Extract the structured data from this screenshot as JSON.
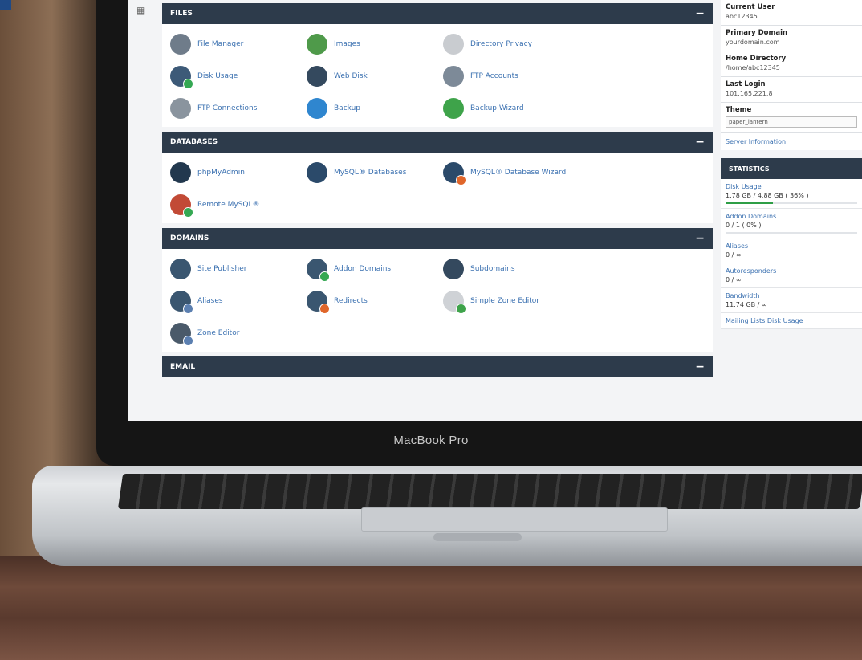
{
  "device": {
    "brand": "MacBook Pro"
  },
  "sections": [
    {
      "title": "FILES",
      "items": [
        {
          "label": "File Manager",
          "color": "#6f7c8a",
          "badge": ""
        },
        {
          "label": "Images",
          "color": "#4f9a4a",
          "badge": ""
        },
        {
          "label": "Directory Privacy",
          "color": "#c9ccd0",
          "badge": ""
        },
        {
          "label": "Disk Usage",
          "color": "#3d5a78",
          "badge": "#35a853"
        },
        {
          "label": "Web Disk",
          "color": "#34495e",
          "badge": ""
        },
        {
          "label": "FTP Accounts",
          "color": "#7d8a98",
          "badge": ""
        },
        {
          "label": "FTP Connections",
          "color": "#8a949e",
          "badge": ""
        },
        {
          "label": "Backup",
          "color": "#2f86cf",
          "badge": ""
        },
        {
          "label": "Backup Wizard",
          "color": "#3ea34a",
          "badge": ""
        }
      ]
    },
    {
      "title": "DATABASES",
      "items": [
        {
          "label": "phpMyAdmin",
          "color": "#22384e",
          "badge": ""
        },
        {
          "label": "MySQL® Databases",
          "color": "#2b4a6a",
          "badge": ""
        },
        {
          "label": "MySQL® Database Wizard",
          "color": "#2b4a6a",
          "badge": "#e0662a"
        },
        {
          "label": "Remote MySQL®",
          "color": "#c24a36",
          "badge": "#35a853"
        }
      ]
    },
    {
      "title": "DOMAINS",
      "items": [
        {
          "label": "Site Publisher",
          "color": "#3a5670",
          "badge": ""
        },
        {
          "label": "Addon Domains",
          "color": "#3a5670",
          "badge": "#35a853"
        },
        {
          "label": "Subdomains",
          "color": "#34495e",
          "badge": ""
        },
        {
          "label": "Aliases",
          "color": "#3a5670",
          "badge": "#5b7fb0"
        },
        {
          "label": "Redirects",
          "color": "#3a5670",
          "badge": "#e0662a"
        },
        {
          "label": "Simple Zone Editor",
          "color": "#cfd2d6",
          "badge": "#3ea34a"
        },
        {
          "label": "Zone Editor",
          "color": "#4a5a6a",
          "badge": "#5b7fb0"
        }
      ]
    },
    {
      "title": "EMAIL",
      "items": []
    }
  ],
  "user_info": [
    {
      "key": "Current User",
      "value": "abc12345"
    },
    {
      "key": "Primary Domain",
      "value": "yourdomain.com"
    },
    {
      "key": "Home Directory",
      "value": "/home/abc12345"
    },
    {
      "key": "Last Login",
      "value": "101.165.221.8"
    }
  ],
  "theme": {
    "label": "Theme",
    "selected": "paper_lantern"
  },
  "server_info_link": "Server Information",
  "statistics": {
    "title": "STATISTICS",
    "items": [
      {
        "key": "Disk Usage",
        "value": "1.78 GB / 4.88 GB ( 36% )",
        "percent": 36
      },
      {
        "key": "Addon Domains",
        "value": "0 / 1 ( 0% )",
        "percent": 0
      },
      {
        "key": "Aliases",
        "value": "0 / ∞"
      },
      {
        "key": "Autoresponders",
        "value": "0 / ∞"
      },
      {
        "key": "Bandwidth",
        "value": "11.74 GB / ∞"
      },
      {
        "key": "Mailing Lists Disk Usage",
        "value": ""
      }
    ]
  }
}
